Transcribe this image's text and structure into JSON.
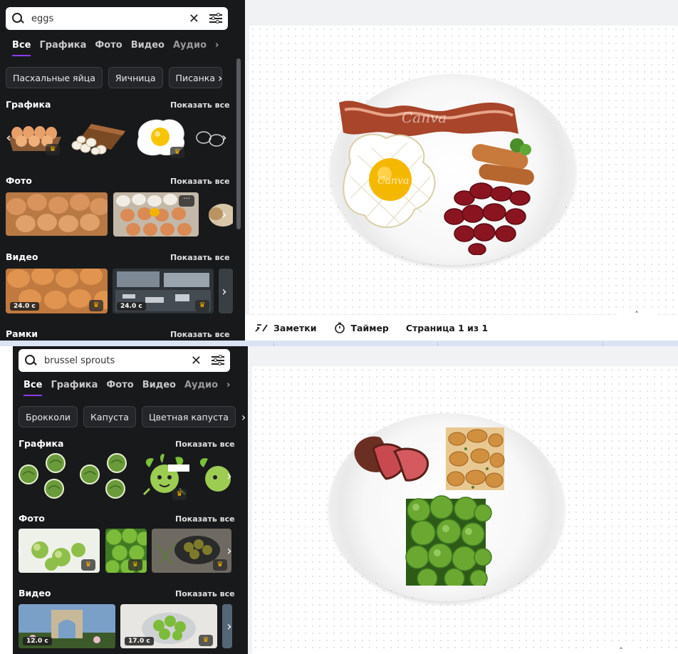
{
  "top": {
    "search": {
      "query": "eggs"
    },
    "tabs": [
      "Все",
      "Графика",
      "Фото",
      "Видео",
      "Аудио"
    ],
    "chips": [
      "Пасхальные яйца",
      "Яичница",
      "Писанка"
    ],
    "sections": {
      "graphics": {
        "title": "Графика",
        "show_all": "Показать все"
      },
      "photos": {
        "title": "Фото",
        "show_all": "Показать все"
      },
      "videos": {
        "title": "Видео",
        "show_all": "Показать все",
        "durations": [
          "24.0 с",
          "24.0 с"
        ]
      },
      "frames": {
        "title": "Рамки",
        "show_all": "Показать все"
      }
    },
    "canvas": {
      "watermark": "Canva"
    },
    "bottom_bar": {
      "notes": "Заметки",
      "timer": "Таймер",
      "page": "Страница 1 из 1"
    }
  },
  "bottom": {
    "search": {
      "query": "brussel sprouts"
    },
    "tabs": [
      "Все",
      "Графика",
      "Фото",
      "Видео",
      "Аудио"
    ],
    "chips": [
      "Брокколи",
      "Капуста",
      "Цветная капуста"
    ],
    "sections": {
      "graphics": {
        "title": "Графика",
        "show_all": "Показать все"
      },
      "photos": {
        "title": "Фото",
        "show_all": "Показать все"
      },
      "videos": {
        "title": "Видео",
        "show_all": "Показать все",
        "durations": [
          "12.0 с",
          "17.0 с"
        ]
      }
    }
  },
  "colors": {
    "panel_bg": "#18191b",
    "accent": "#8b3dff",
    "premium": "#f5b300"
  }
}
